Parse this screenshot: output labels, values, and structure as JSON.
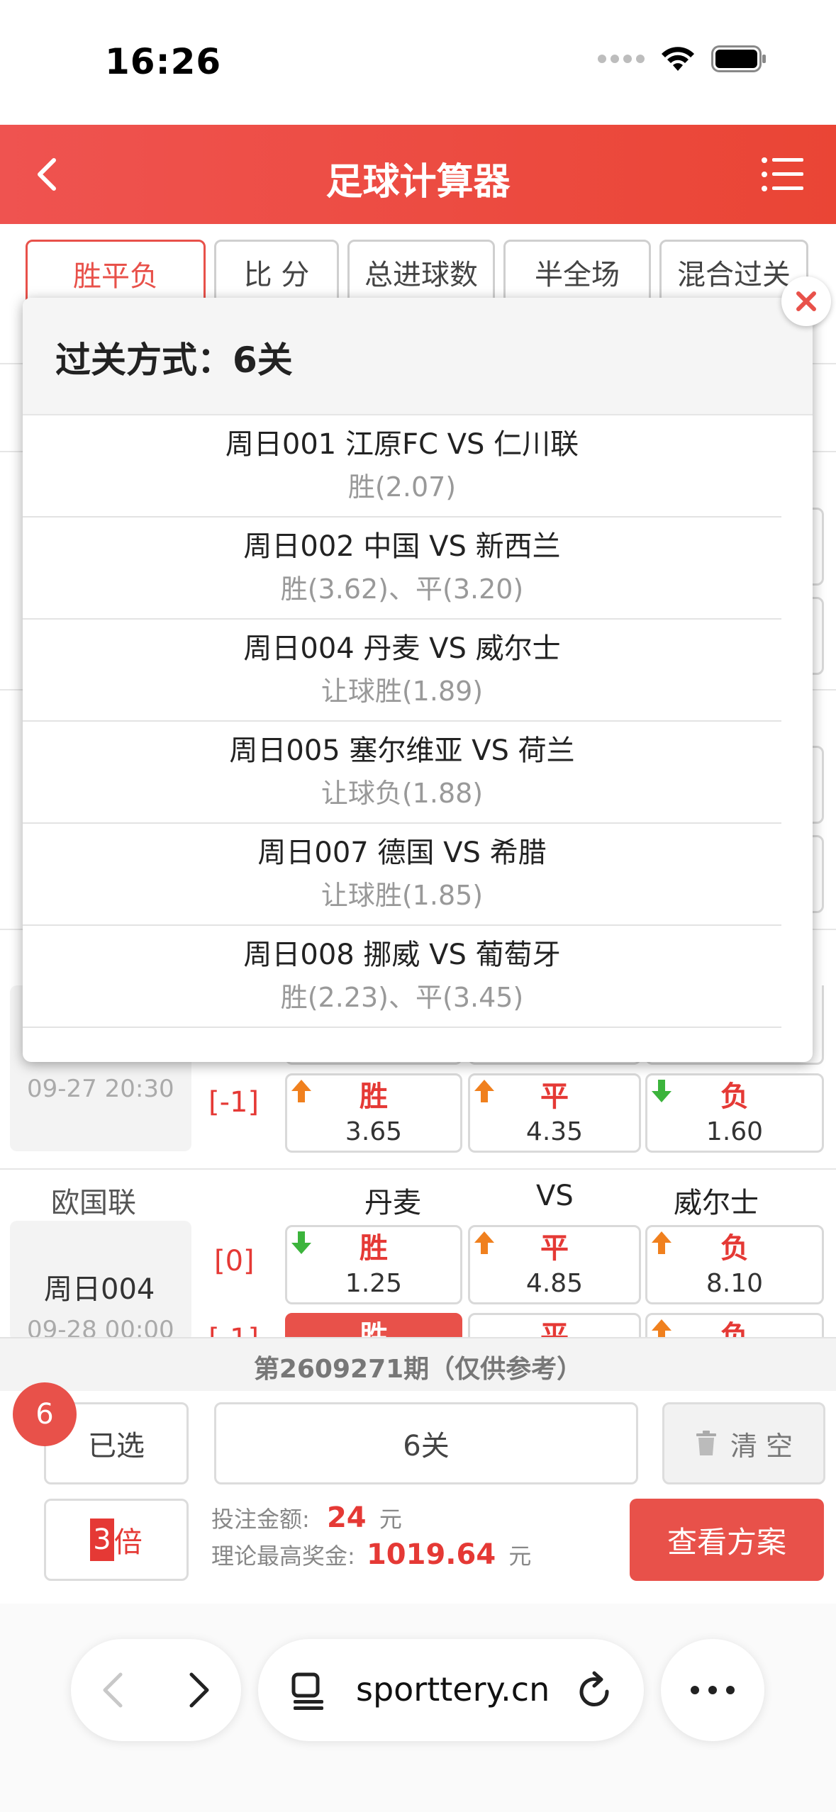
{
  "status_bar": {
    "time": "16:26"
  },
  "header": {
    "title": "足球计算器"
  },
  "tabs": [
    {
      "label": "胜平负",
      "active": true
    },
    {
      "label": "比 分",
      "active": false
    },
    {
      "label": "总进球数",
      "active": false
    },
    {
      "label": "半全场",
      "active": false
    },
    {
      "label": "混合过关",
      "active": false
    }
  ],
  "background_matches": {
    "row_a": {
      "time": "09-27 20:30",
      "handicap": "[-1]",
      "odds": [
        {
          "label": "胜",
          "value": "3.65",
          "trend": "up"
        },
        {
          "label": "平",
          "value": "4.35",
          "trend": "up"
        },
        {
          "label": "负",
          "value": "1.60",
          "trend": "down"
        }
      ]
    },
    "row_b": {
      "league": "欧国联",
      "home": "丹麦",
      "vs": "VS",
      "away": "威尔士",
      "match_no": "周日004",
      "time": "09-28 00:00",
      "handicap": "[0]",
      "odds": [
        {
          "label": "胜",
          "value": "1.25",
          "trend": "down"
        },
        {
          "label": "平",
          "value": "4.85",
          "trend": "up"
        },
        {
          "label": "负",
          "value": "8.10",
          "trend": "up"
        }
      ],
      "second_odds": [
        {
          "label": "胜"
        },
        {
          "label": "平"
        },
        {
          "label": "负"
        }
      ]
    }
  },
  "popup": {
    "title": "过关方式：6关",
    "items": [
      {
        "match": "周日001 江原FC VS 仁川联",
        "pick": "胜(2.07)"
      },
      {
        "match": "周日002 中国 VS 新西兰",
        "pick": "胜(3.62)、平(3.20)"
      },
      {
        "match": "周日004 丹麦 VS 威尔士",
        "pick": "让球胜(1.89)"
      },
      {
        "match": "周日005 塞尔维亚 VS 荷兰",
        "pick": "让球负(1.88)"
      },
      {
        "match": "周日007 德国 VS 希腊",
        "pick": "让球胜(1.85)"
      },
      {
        "match": "周日008 挪威 VS 葡萄牙",
        "pick": "胜(2.23)、平(3.45)"
      }
    ]
  },
  "bottom": {
    "period": "第2609271期（仅供参考）",
    "selected_count": "6",
    "selected_label": "已选",
    "pass_type": "6关",
    "clear_label": "清 空",
    "multiplier_value": "3",
    "multiplier_unit": "倍",
    "bet_amount_label": "投注金额:",
    "bet_amount": "24",
    "bet_unit": "元",
    "max_prize_label": "理论最高奖金:",
    "max_prize": "1019.64",
    "prize_unit": "元",
    "view_plan_label": "查看方案"
  },
  "browser": {
    "url": "sporttery.cn"
  },
  "colors": {
    "accent": "#e8514a",
    "up_arrow": "#f0801e",
    "down_arrow": "#3cb43c"
  }
}
